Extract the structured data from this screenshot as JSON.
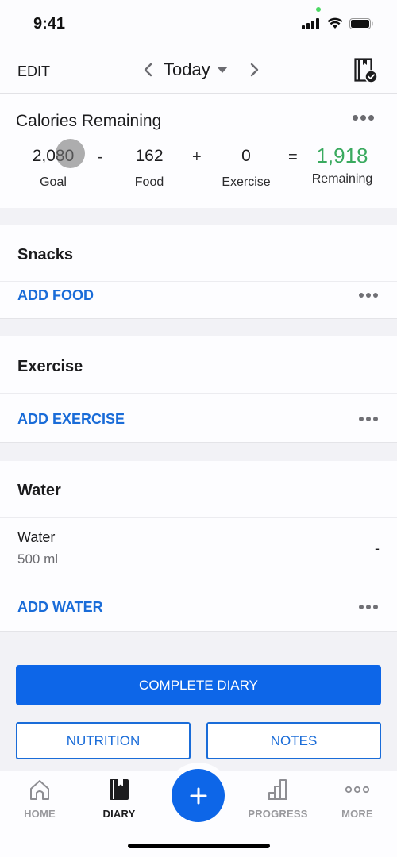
{
  "status_bar": {
    "time": "9:41",
    "icons": [
      "cellular-signal-icon",
      "wifi-icon",
      "battery-icon"
    ],
    "privacy_indicator_color": "#4cd964"
  },
  "nav": {
    "edit_label": "EDIT",
    "date_label": "Today",
    "prev_icon": "chevron-left-icon",
    "next_icon": "chevron-right-icon",
    "dropdown_icon": "caret-down-icon",
    "complete_icon": "diary-check-icon"
  },
  "calories": {
    "title": "Calories Remaining",
    "goal": {
      "value": "2,080",
      "label": "Goal"
    },
    "minus": "-",
    "food": {
      "value": "162",
      "label": "Food"
    },
    "plus": "+",
    "exercise": {
      "value": "0",
      "label": "Exercise"
    },
    "equals": "=",
    "remaining": {
      "value": "1,918",
      "label": "Remaining"
    },
    "remaining_color": "#3aaa5f"
  },
  "snacks": {
    "title": "Snacks",
    "add_label": "ADD FOOD"
  },
  "exercise": {
    "title": "Exercise",
    "add_label": "ADD EXERCISE"
  },
  "water": {
    "title": "Water",
    "entries": [
      {
        "name": "Water",
        "amount": "500 ml",
        "calories": "-"
      }
    ],
    "add_label": "ADD WATER"
  },
  "actions": {
    "complete_label": "COMPLETE DIARY",
    "nutrition_label": "NUTRITION",
    "notes_label": "NOTES",
    "accent_color": "#0d66e8"
  },
  "tab_bar": {
    "items": [
      {
        "label": "HOME",
        "icon": "home-icon",
        "active": false
      },
      {
        "label": "DIARY",
        "icon": "diary-book-icon",
        "active": true
      },
      {
        "label": "",
        "icon": "plus-icon",
        "active": false
      },
      {
        "label": "PROGRESS",
        "icon": "bar-chart-icon",
        "active": false
      },
      {
        "label": "MORE",
        "icon": "more-dots-icon",
        "active": false
      }
    ]
  }
}
